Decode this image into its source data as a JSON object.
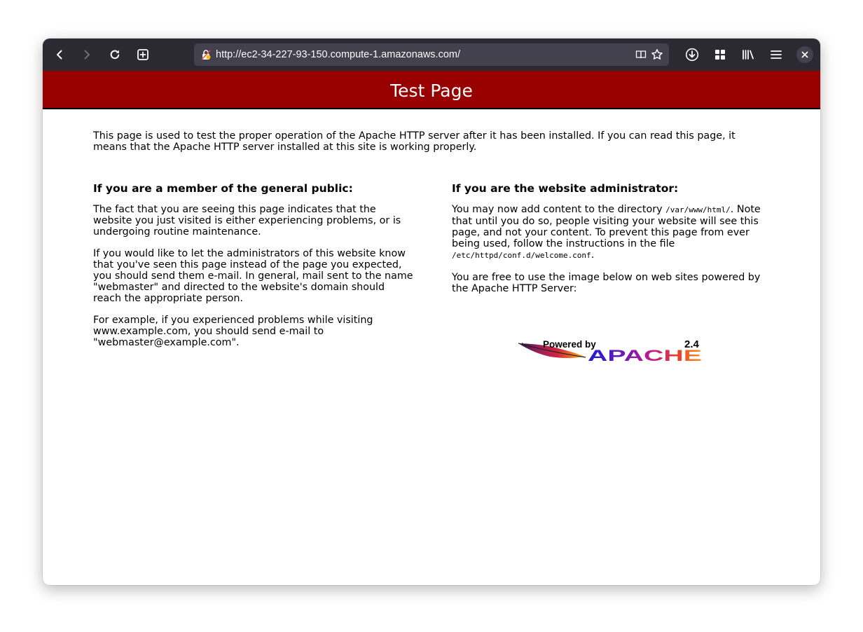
{
  "browser": {
    "url": "http://ec2-34-227-93-150.compute-1.amazonaws.com/",
    "icons": {
      "back": "back-arrow-icon",
      "forward": "forward-arrow-icon",
      "reload": "reload-icon",
      "new_tab": "new-tab-icon",
      "lock": "insecure-lock-icon",
      "reader": "reader-view-icon",
      "bookmark": "bookmark-star-icon",
      "downloads": "download-icon",
      "extensions": "grid-icon",
      "library": "library-icon",
      "menu": "hamburger-menu-icon",
      "close": "close-icon"
    },
    "colors": {
      "toolbar": "#2b2a33",
      "urlbar": "#42414d"
    }
  },
  "page": {
    "banner_title": "Test Page",
    "banner_color": "#990000",
    "intro": "This page is used to test the proper operation of the Apache HTTP server after it has been installed. If you can read this page, it means that the Apache HTTP server installed at this site is working properly.",
    "left": {
      "heading": "If you are a member of the general public:",
      "p1": "The fact that you are seeing this page indicates that the website you just visited is either experiencing problems, or is undergoing routine maintenance.",
      "p2": "If you would like to let the administrators of this website know that you've seen this page instead of the page you expected, you should send them e-mail. In general, mail sent to the name \"webmaster\" and directed to the website's domain should reach the appropriate person.",
      "p3": "For example, if you experienced problems while visiting www.example.com, you should send e-mail to \"webmaster@example.com\"."
    },
    "right": {
      "heading": "If you are the website administrator:",
      "p1_a": "You may now add content to the directory ",
      "p1_dir": "/var/www/html/",
      "p1_b": ". Note that until you do so, people visiting your website will see this page, and not your content. To prevent this page from ever being used, follow the instructions in the file ",
      "p1_file": "/etc/httpd/conf.d/welcome.conf",
      "p1_c": ".",
      "p2": "You are free to use the image below on web sites powered by the Apache HTTP Server:"
    },
    "logo": {
      "powered_by": "Powered by",
      "version": "2.4",
      "name": "APACHE"
    }
  }
}
